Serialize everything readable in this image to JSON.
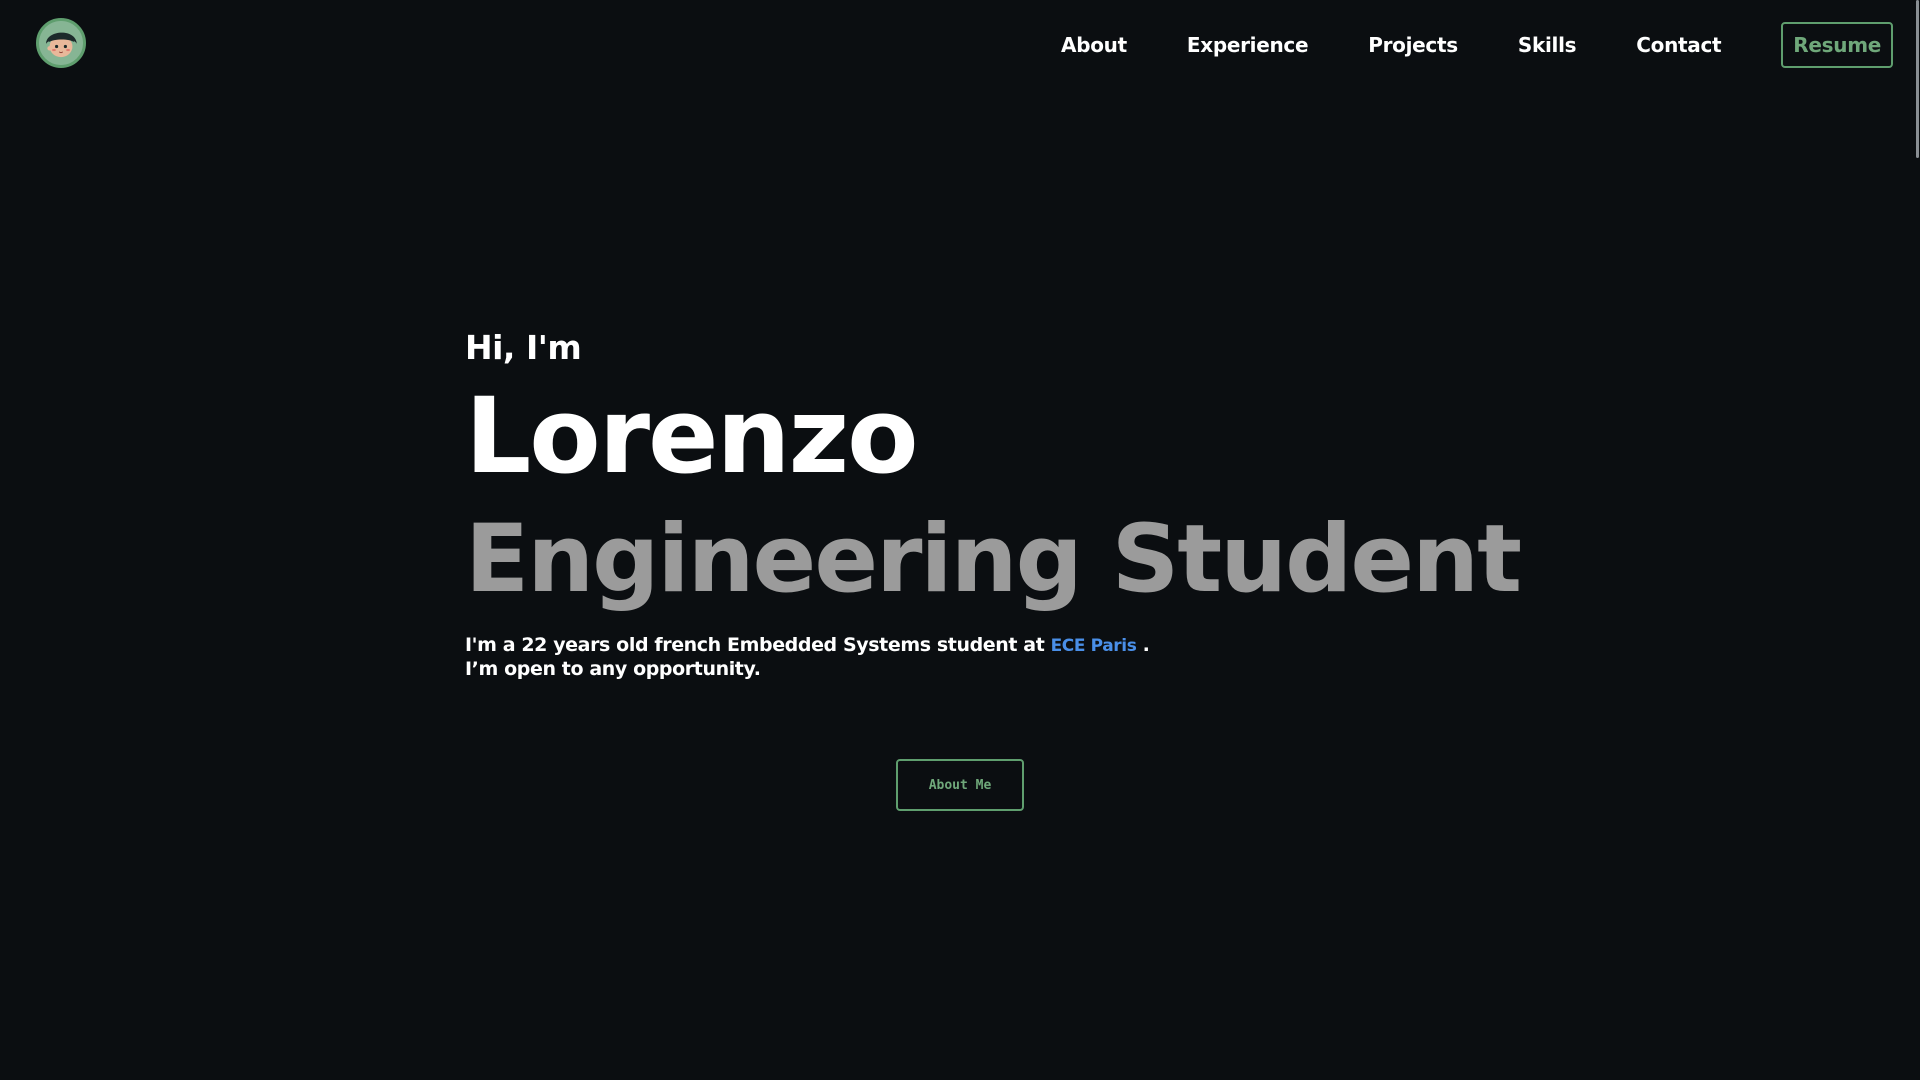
{
  "logo": {
    "icon": "avatar-icon"
  },
  "nav": {
    "items": [
      {
        "label": "About"
      },
      {
        "label": "Experience"
      },
      {
        "label": "Projects"
      },
      {
        "label": "Skills"
      },
      {
        "label": "Contact"
      }
    ],
    "resume_label": "Resume"
  },
  "hero": {
    "greeting": "Hi, I'm",
    "name": "Lorenzo",
    "role": "Engineering Student",
    "intro_line1_prefix": "I'm a 22 years old french Embedded Systems student at ",
    "school": "ECE Paris",
    "intro_line1_suffix": " .",
    "intro_line2": "I’m open to any opportunity."
  },
  "cta": {
    "label": "About Me"
  },
  "colors": {
    "background": "#0b0e11",
    "accent_green": "#5f9e6e",
    "link_blue": "#4a8fe8",
    "role_gray": "#9b9b9b"
  }
}
